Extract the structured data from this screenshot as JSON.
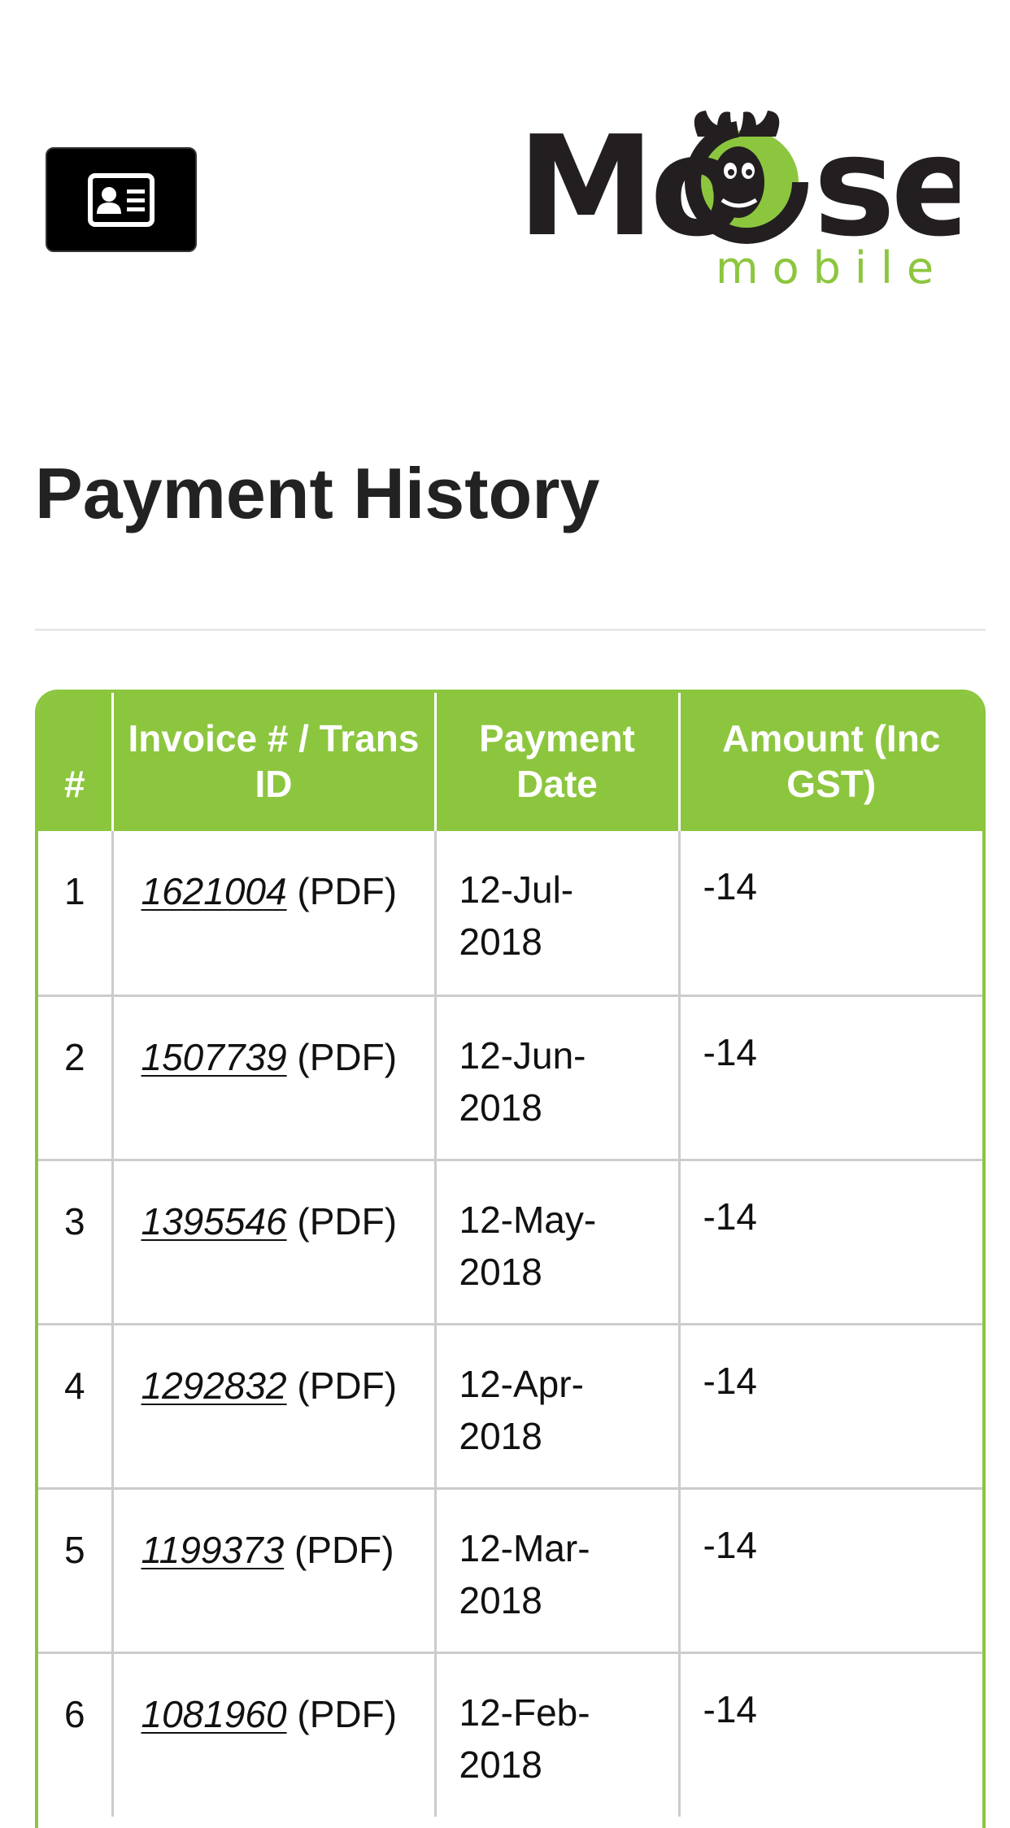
{
  "header": {
    "profile_button_icon": "id-card-icon",
    "logo": {
      "word": "Moose",
      "sub": "mobile",
      "colors": {
        "dark": "#231f20",
        "green": "#8cc63f"
      }
    }
  },
  "page": {
    "title": "Payment History"
  },
  "table": {
    "header_color": "#8cc63f",
    "columns": [
      "#",
      "Invoice # / Trans ID",
      "Payment Date",
      "Amount (Inc GST)"
    ],
    "rows": [
      {
        "num": "1",
        "invoice": "1621004",
        "pdf": "(PDF)",
        "date": "12-Jul-2018",
        "amount": "-14"
      },
      {
        "num": "2",
        "invoice": "1507739",
        "pdf": "(PDF)",
        "date": "12-Jun-2018",
        "amount": "-14"
      },
      {
        "num": "3",
        "invoice": "1395546",
        "pdf": "(PDF)",
        "date": "12-May-2018",
        "amount": "-14"
      },
      {
        "num": "4",
        "invoice": "1292832",
        "pdf": "(PDF)",
        "date": "12-Apr-2018",
        "amount": "-14"
      },
      {
        "num": "5",
        "invoice": "1199373",
        "pdf": "(PDF)",
        "date": "12-Mar-2018",
        "amount": "-14"
      },
      {
        "num": "6",
        "invoice": "1081960",
        "pdf": "(PDF)",
        "date": "12-Feb-2018",
        "amount": "-14"
      }
    ]
  }
}
